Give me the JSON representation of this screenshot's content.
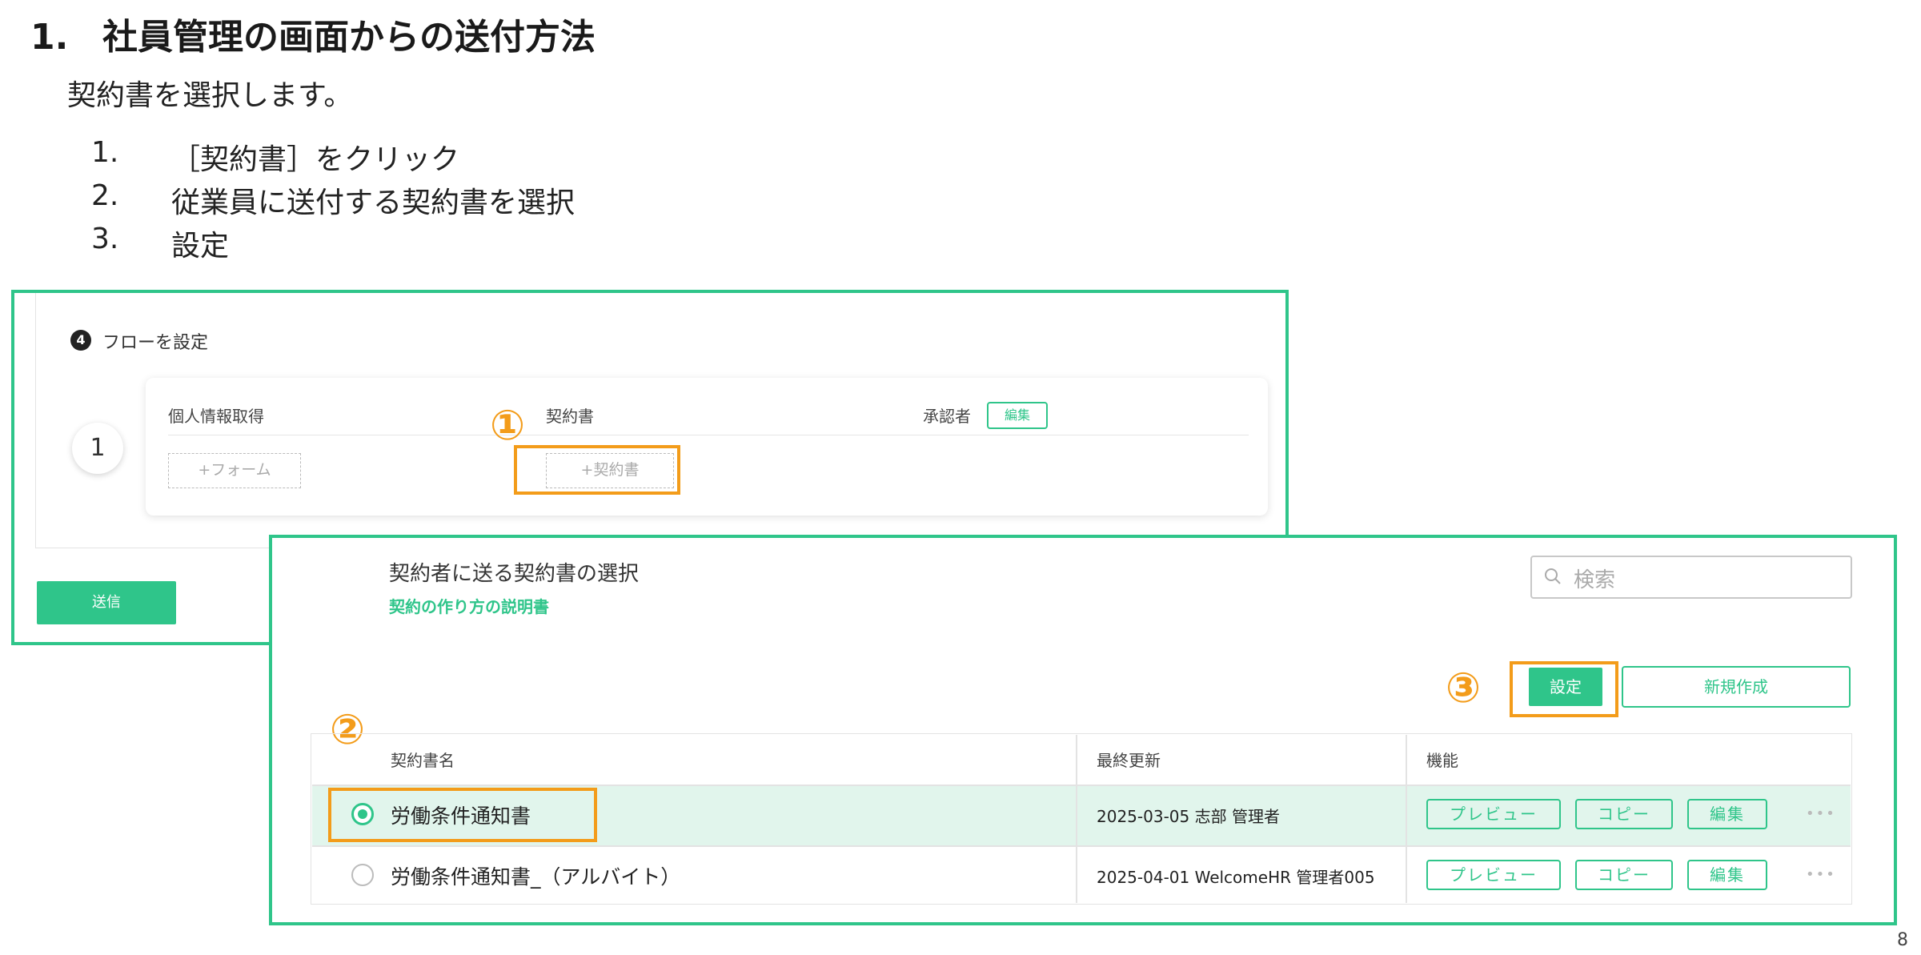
{
  "slide": {
    "title_num": "1.",
    "title_text": "社員管理の画面からの送付方法",
    "intro": "契約書を選択します。",
    "steps": [
      {
        "n": "1.",
        "text": "［契約書］をクリック"
      },
      {
        "n": "2.",
        "text": "従業員に送付する契約書を選択"
      },
      {
        "n": "3.",
        "text": "設定"
      }
    ],
    "page_number": "8"
  },
  "markers": {
    "m1": "①",
    "m2": "②",
    "m3": "③"
  },
  "flow": {
    "badge": "4",
    "label": "フローを設定",
    "step_number": "1",
    "columns": {
      "personal_info": "個人情報取得",
      "contract": "契約書",
      "approver": "承認者"
    },
    "edit_label": "編集",
    "add_form": "+フォーム",
    "add_contract": "+契約書",
    "send_label": "送信"
  },
  "dialog": {
    "title": "契約者に送る契約書の選択",
    "help_link": "契約の作り方の説明書",
    "search_placeholder": "検索",
    "set_label": "設定",
    "new_label": "新規作成",
    "table": {
      "headers": {
        "name": "契約書名",
        "updated": "最終更新",
        "functions": "機能"
      },
      "rows": [
        {
          "name": "労働条件通知書",
          "updated": "2025-03-05 志部 管理者",
          "selected": true
        },
        {
          "name": "労働条件通知書_（アルバイト）",
          "updated": "2025-04-01 WelcomeHR 管理者005",
          "selected": false
        }
      ],
      "actions": {
        "preview": "プレビュー",
        "copy": "コピー",
        "edit": "編集",
        "more": "•••"
      }
    }
  },
  "colors": {
    "accent": "#2fc58a",
    "highlight": "#f39c1a",
    "selected_row": "#e1f5ec"
  }
}
